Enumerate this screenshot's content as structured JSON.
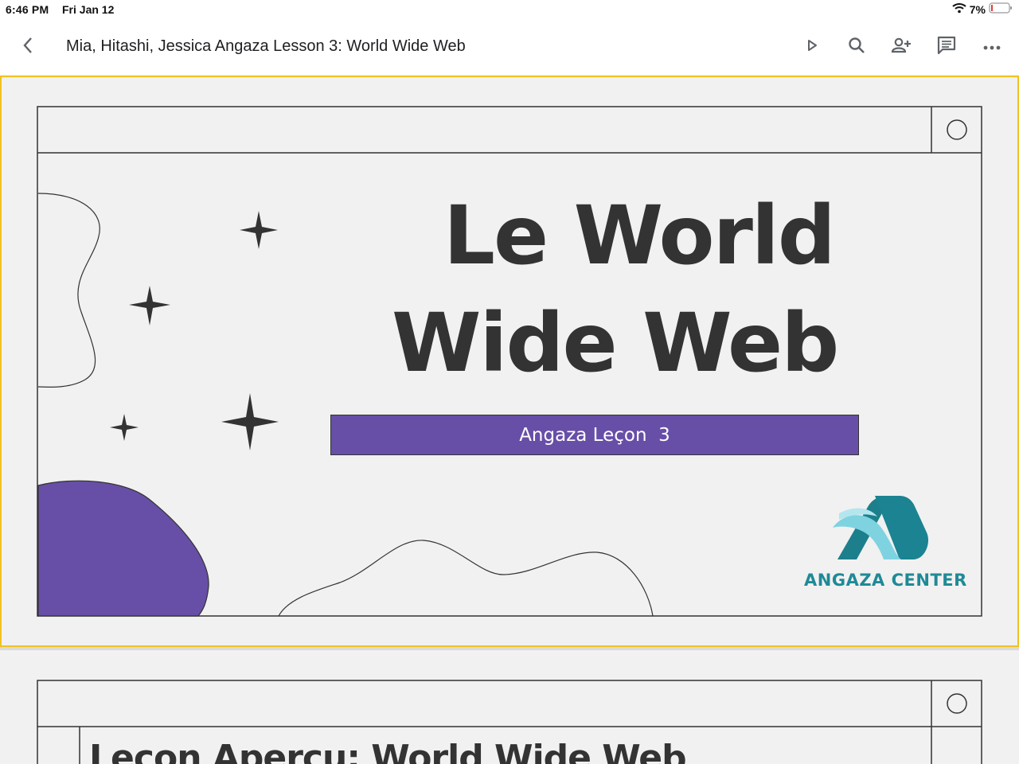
{
  "status_bar": {
    "time": "6:46 PM",
    "date": "Fri Jan 12",
    "battery": "7%",
    "icons": [
      "wifi-icon",
      "battery-icon"
    ]
  },
  "app_bar": {
    "title": "Mia, Hitashi, Jessica Angaza Lesson 3: World Wide Web",
    "icons": [
      "back-arrow-icon",
      "present-play-icon",
      "search-icon",
      "add-person-icon",
      "comment-icon",
      "more-horiz-icon"
    ]
  },
  "slide1": {
    "title_line1": "Le World",
    "title_line2": "Wide Web",
    "subtitle": "Angaza Leçon  3",
    "logo_text": "ANGAZA CENTER",
    "colors": {
      "accent_purple": "#674ea7",
      "selection_border": "#f0c224",
      "logo_teal": "#1f8a96",
      "title_text": "#333333"
    }
  },
  "slide2": {
    "title_partial": "Leçon Aperçu: World Wide Web"
  }
}
